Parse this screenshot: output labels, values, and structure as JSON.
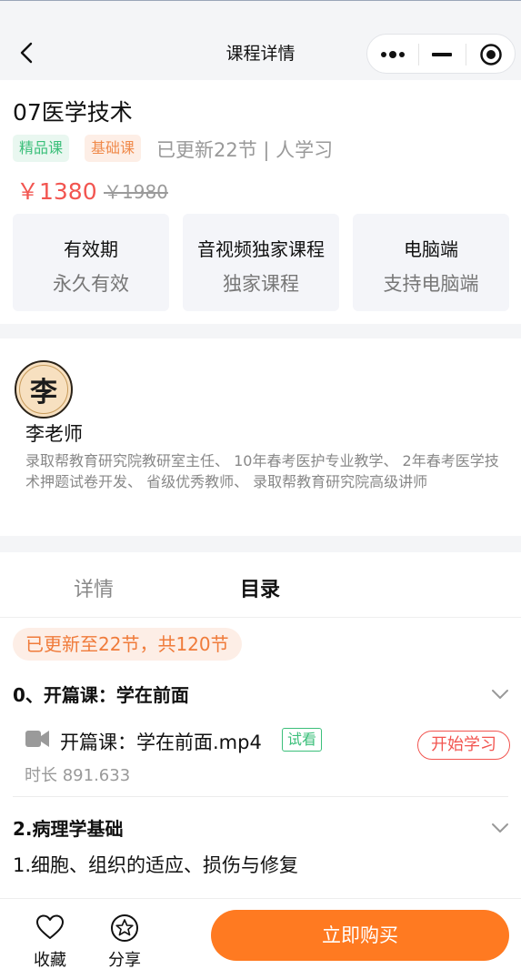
{
  "nav": {
    "title": "课程详情",
    "back_icon": "chevron-left-icon",
    "capsule_icons": [
      "more-dots-icon",
      "minimize-icon",
      "target-circle-icon"
    ]
  },
  "course": {
    "title": "07医学技术",
    "tags": [
      "精品课",
      "基础课"
    ],
    "meta": "已更新22节 | 人学习",
    "price": "￥1380",
    "original_price": "￥1980",
    "features": [
      {
        "title": "有效期",
        "value": "永久有效"
      },
      {
        "title": "音视频独家课程",
        "value": "独家课程"
      },
      {
        "title": "电脑端",
        "value": "支持电脑端"
      }
    ]
  },
  "teacher": {
    "avatar_char": "李",
    "name": "李老师",
    "bio": "录取帮教育研究院教研室主任、 10年春考医护专业教学、 2年春考医学技术押题试卷开发、 省级优秀教师、 录取帮教育研究院高级讲师"
  },
  "tabs": {
    "details": "详情",
    "catalog": "目录",
    "active": "catalog"
  },
  "catalog": {
    "update_badge": "已更新至22节，共120节",
    "sections": [
      {
        "title": "0、开篇课：学在前面",
        "lesson": {
          "title": "开篇课：学在前面.mp4",
          "trial_label": "试看",
          "start_label": "开始学习",
          "duration": "时长 891.633"
        }
      },
      {
        "title": "2.病理学基础",
        "sub_item": "1.细胞、组织的适应、损伤与修复"
      }
    ]
  },
  "bottom": {
    "favorite_label": "收藏",
    "share_label": "分享",
    "buy_label": "立即购买"
  },
  "colors": {
    "accent": "#ff7a21",
    "price_red": "#f25550",
    "green_tag": "#3bbf7a"
  }
}
